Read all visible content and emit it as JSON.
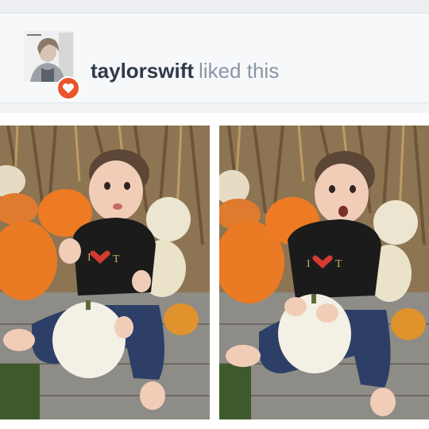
{
  "notification": {
    "username": "taylorswift",
    "action": "liked this",
    "avatar_icon": "album-cover-avatar",
    "badge_icon": "heart-icon",
    "badge_color": "#e8552b"
  },
  "photos": [
    {
      "label": "toddler-with-pumpkins-left"
    },
    {
      "label": "toddler-with-pumpkins-right"
    }
  ]
}
